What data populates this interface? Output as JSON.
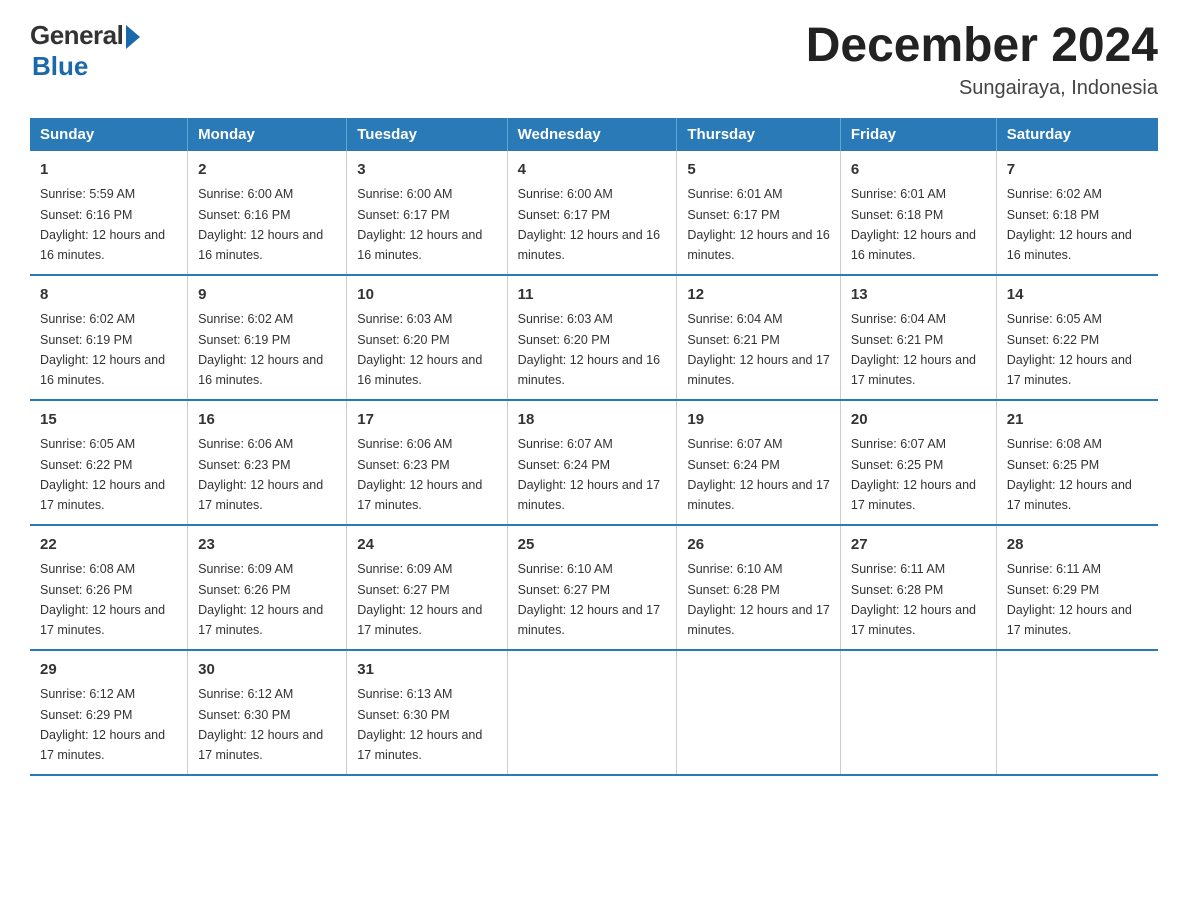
{
  "logo": {
    "general": "General",
    "blue": "Blue",
    "tagline": "Blue"
  },
  "title": "December 2024",
  "location": "Sungairaya, Indonesia",
  "weekdays": [
    "Sunday",
    "Monday",
    "Tuesday",
    "Wednesday",
    "Thursday",
    "Friday",
    "Saturday"
  ],
  "weeks": [
    [
      {
        "day": "1",
        "sunrise": "5:59 AM",
        "sunset": "6:16 PM",
        "daylight": "12 hours and 16 minutes."
      },
      {
        "day": "2",
        "sunrise": "6:00 AM",
        "sunset": "6:16 PM",
        "daylight": "12 hours and 16 minutes."
      },
      {
        "day": "3",
        "sunrise": "6:00 AM",
        "sunset": "6:17 PM",
        "daylight": "12 hours and 16 minutes."
      },
      {
        "day": "4",
        "sunrise": "6:00 AM",
        "sunset": "6:17 PM",
        "daylight": "12 hours and 16 minutes."
      },
      {
        "day": "5",
        "sunrise": "6:01 AM",
        "sunset": "6:17 PM",
        "daylight": "12 hours and 16 minutes."
      },
      {
        "day": "6",
        "sunrise": "6:01 AM",
        "sunset": "6:18 PM",
        "daylight": "12 hours and 16 minutes."
      },
      {
        "day": "7",
        "sunrise": "6:02 AM",
        "sunset": "6:18 PM",
        "daylight": "12 hours and 16 minutes."
      }
    ],
    [
      {
        "day": "8",
        "sunrise": "6:02 AM",
        "sunset": "6:19 PM",
        "daylight": "12 hours and 16 minutes."
      },
      {
        "day": "9",
        "sunrise": "6:02 AM",
        "sunset": "6:19 PM",
        "daylight": "12 hours and 16 minutes."
      },
      {
        "day": "10",
        "sunrise": "6:03 AM",
        "sunset": "6:20 PM",
        "daylight": "12 hours and 16 minutes."
      },
      {
        "day": "11",
        "sunrise": "6:03 AM",
        "sunset": "6:20 PM",
        "daylight": "12 hours and 16 minutes."
      },
      {
        "day": "12",
        "sunrise": "6:04 AM",
        "sunset": "6:21 PM",
        "daylight": "12 hours and 17 minutes."
      },
      {
        "day": "13",
        "sunrise": "6:04 AM",
        "sunset": "6:21 PM",
        "daylight": "12 hours and 17 minutes."
      },
      {
        "day": "14",
        "sunrise": "6:05 AM",
        "sunset": "6:22 PM",
        "daylight": "12 hours and 17 minutes."
      }
    ],
    [
      {
        "day": "15",
        "sunrise": "6:05 AM",
        "sunset": "6:22 PM",
        "daylight": "12 hours and 17 minutes."
      },
      {
        "day": "16",
        "sunrise": "6:06 AM",
        "sunset": "6:23 PM",
        "daylight": "12 hours and 17 minutes."
      },
      {
        "day": "17",
        "sunrise": "6:06 AM",
        "sunset": "6:23 PM",
        "daylight": "12 hours and 17 minutes."
      },
      {
        "day": "18",
        "sunrise": "6:07 AM",
        "sunset": "6:24 PM",
        "daylight": "12 hours and 17 minutes."
      },
      {
        "day": "19",
        "sunrise": "6:07 AM",
        "sunset": "6:24 PM",
        "daylight": "12 hours and 17 minutes."
      },
      {
        "day": "20",
        "sunrise": "6:07 AM",
        "sunset": "6:25 PM",
        "daylight": "12 hours and 17 minutes."
      },
      {
        "day": "21",
        "sunrise": "6:08 AM",
        "sunset": "6:25 PM",
        "daylight": "12 hours and 17 minutes."
      }
    ],
    [
      {
        "day": "22",
        "sunrise": "6:08 AM",
        "sunset": "6:26 PM",
        "daylight": "12 hours and 17 minutes."
      },
      {
        "day": "23",
        "sunrise": "6:09 AM",
        "sunset": "6:26 PM",
        "daylight": "12 hours and 17 minutes."
      },
      {
        "day": "24",
        "sunrise": "6:09 AM",
        "sunset": "6:27 PM",
        "daylight": "12 hours and 17 minutes."
      },
      {
        "day": "25",
        "sunrise": "6:10 AM",
        "sunset": "6:27 PM",
        "daylight": "12 hours and 17 minutes."
      },
      {
        "day": "26",
        "sunrise": "6:10 AM",
        "sunset": "6:28 PM",
        "daylight": "12 hours and 17 minutes."
      },
      {
        "day": "27",
        "sunrise": "6:11 AM",
        "sunset": "6:28 PM",
        "daylight": "12 hours and 17 minutes."
      },
      {
        "day": "28",
        "sunrise": "6:11 AM",
        "sunset": "6:29 PM",
        "daylight": "12 hours and 17 minutes."
      }
    ],
    [
      {
        "day": "29",
        "sunrise": "6:12 AM",
        "sunset": "6:29 PM",
        "daylight": "12 hours and 17 minutes."
      },
      {
        "day": "30",
        "sunrise": "6:12 AM",
        "sunset": "6:30 PM",
        "daylight": "12 hours and 17 minutes."
      },
      {
        "day": "31",
        "sunrise": "6:13 AM",
        "sunset": "6:30 PM",
        "daylight": "12 hours and 17 minutes."
      },
      null,
      null,
      null,
      null
    ]
  ]
}
